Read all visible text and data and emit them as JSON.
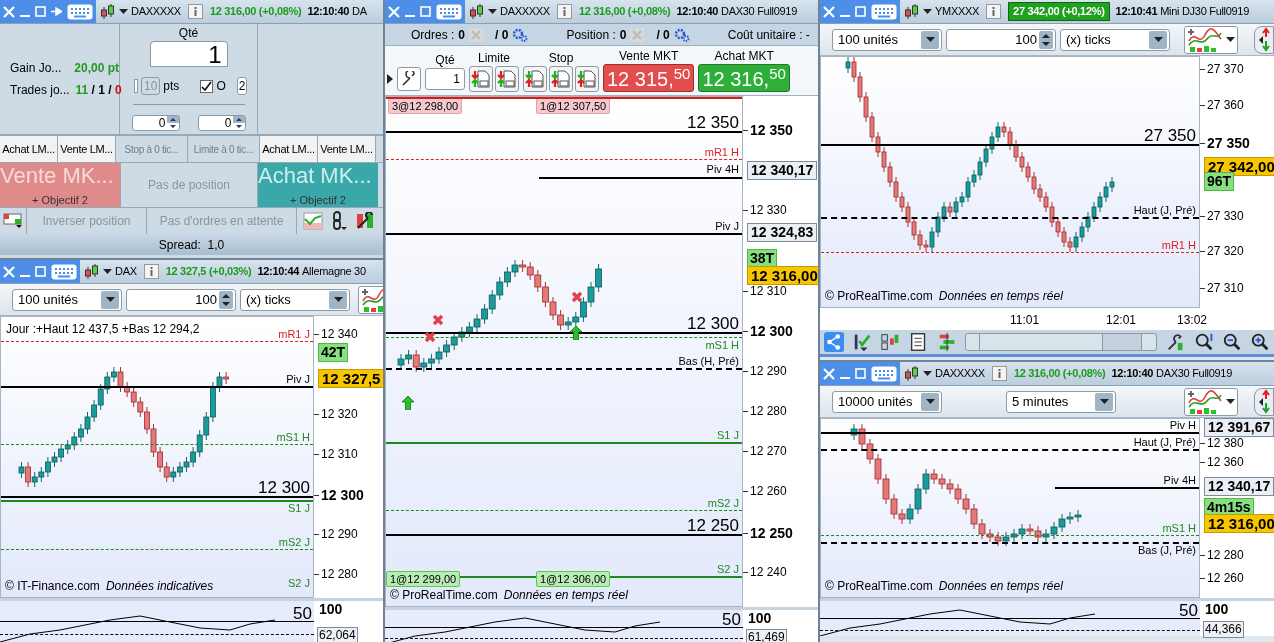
{
  "windows": [
    {
      "kind": "ticket",
      "title": {
        "symbol": "DAXXXXX",
        "price": "12 316,00 (+0,08%)",
        "time": "12:10:40",
        "name": "DA",
        "highlighted": false
      },
      "stats": [
        {
          "label": "Gain Jo...",
          "parts": [
            {
              "kind": "gain",
              "text": "20,00 pt"
            }
          ]
        },
        {
          "label": "Trades jo...",
          "parts": [
            {
              "kind": "gain",
              "text": "11"
            },
            {
              "kind": "neutral",
              "text": " / 1 / "
            },
            {
              "kind": "loss",
              "text": "0"
            }
          ]
        }
      ],
      "qty_label": "Qté",
      "qty": "1",
      "distance_enabled": false,
      "distance": "10",
      "distance_unit": "pts",
      "option": {
        "label": "O",
        "checked": true,
        "value": "2"
      },
      "spinners": [
        "0",
        "0"
      ],
      "order_buttons": [
        {
          "label": "Achat LM...",
          "disabled": false
        },
        {
          "label": "Vente LM...",
          "disabled": false
        },
        {
          "label": "Stop à 0 tic...",
          "disabled": true
        },
        {
          "label": "Limite à 0 tic...",
          "disabled": true
        },
        {
          "label": "Achat LM...",
          "disabled": false
        },
        {
          "label": "Vente LM...",
          "disabled": false
        }
      ],
      "sell": {
        "label": "Vente MK...",
        "sub": "+ Objectif 2"
      },
      "position": "Pas de position",
      "buy": {
        "label": "Achat MK...",
        "sub": "+ Objectif 2"
      },
      "actions": [
        {
          "label": "Inverser position",
          "disabled": true
        },
        {
          "label": "Pas d'ordres en attente",
          "disabled": true
        }
      ],
      "spread": "Spread:  1,0"
    },
    {
      "kind": "chart",
      "title": {
        "symbol": "DAX",
        "price": "12 327,5 (+0,03%)",
        "time": "12:10:44",
        "name": "Allemagne 30",
        "highlighted": false
      },
      "toolbar": [
        {
          "kind": "select",
          "value": "100 unités"
        },
        {
          "kind": "spinner",
          "value": "100"
        },
        {
          "kind": "select",
          "value": "(x) ticks"
        }
      ],
      "info": "Jour :+Haut 12 437,5 +Bas 12 294,2",
      "levels": [
        {
          "kind": "long-dash",
          "label": "mR1 J",
          "color": "#e02020"
        },
        {
          "kind": "solid",
          "label": "Piv J",
          "color": "#000000"
        },
        {
          "kind": "long-dash",
          "label": "mS1 H",
          "color": "#1e8a1e"
        },
        {
          "kind": "round",
          "label": "12 300",
          "color": "#000000"
        },
        {
          "kind": "line",
          "label": "S1 J",
          "color": "#1e8a1e"
        },
        {
          "kind": "long-dash",
          "label": "mS2 J",
          "color": "#1e8a1e"
        },
        {
          "kind": "label",
          "label": "S2 J",
          "color": "#1e8a1e"
        }
      ],
      "axis": [
        {
          "text": "12 340",
          "bold": false
        },
        {
          "text": "12 320",
          "bold": false
        },
        {
          "text": "12 310",
          "bold": false
        },
        {
          "text": "12 300",
          "bold": true
        },
        {
          "text": "12 290",
          "bold": false
        },
        {
          "text": "12 280",
          "bold": false
        }
      ],
      "tags": [
        {
          "kind": "timer",
          "text": "42T"
        },
        {
          "kind": "last",
          "text": "12 327,5"
        }
      ],
      "footer": {
        "source": "© IT-Finance.com",
        "note": "Données indicatives"
      },
      "indicator": {
        "max": "100",
        "mid": "50",
        "value": "62,064"
      }
    },
    {
      "kind": "chart",
      "title": {
        "symbol": "DAXXXXX",
        "price": "12 316,00 (+0,08%)",
        "time": "12:10:40",
        "name": "DAX30 Full0919",
        "highlighted": false
      },
      "order_bar": [
        {
          "label": "Ordres :",
          "count": "0",
          "pending": "/ 0"
        },
        {
          "label": "Position :",
          "count": "0",
          "pending": "/ 0"
        }
      ],
      "unit_cost": "Coût unitaire : -",
      "trade_bar": {
        "qty_label": "Qté",
        "qty": "1",
        "limit_label": "Limite",
        "stop_label": "Stop",
        "sell_label": "Vente MKT",
        "sell_price": "12 315,$^{50}$",
        "buy_label": "Achat MKT",
        "buy_price": "12 316,$^{50}$"
      },
      "order_tags": [
        {
          "kind": "stop",
          "text": "3@12 298,00"
        },
        {
          "kind": "stop",
          "text": "1@12 307,50"
        },
        {
          "kind": "target",
          "text": "1@12 299,00"
        },
        {
          "kind": "target",
          "text": "1@12 306,00"
        }
      ],
      "levels": [
        {
          "kind": "round",
          "label": "12 350",
          "color": "#000000"
        },
        {
          "kind": "long-dash",
          "label": "mR1 H",
          "color": "#e02020"
        },
        {
          "kind": "label",
          "label": "Piv 4H",
          "color": "#000000"
        },
        {
          "kind": "solid",
          "color": "#000000"
        },
        {
          "kind": "solid",
          "label": "Piv J",
          "color": "#000000"
        },
        {
          "kind": "round",
          "label": "12 300",
          "color": "#000000"
        },
        {
          "kind": "long-dash",
          "label": "mS1 H",
          "color": "#1e8a1e"
        },
        {
          "kind": "dashed",
          "label": "Bas (H, Pré)",
          "color": "#000000"
        },
        {
          "kind": "line",
          "label": "S1 J",
          "color": "#1e8a1e"
        },
        {
          "kind": "long-dash",
          "label": "mS2 J",
          "color": "#1e8a1e"
        },
        {
          "kind": "round",
          "label": "12 250",
          "color": "#000000"
        },
        {
          "kind": "line",
          "label": "S2 J",
          "color": "#1e8a1e"
        }
      ],
      "axis": [
        {
          "text": "12 350",
          "bold": true
        },
        {
          "text": "12 330",
          "bold": false
        },
        {
          "text": "12 310",
          "bold": false
        },
        {
          "text": "12 300",
          "bold": true
        },
        {
          "text": "12 290",
          "bold": false
        },
        {
          "text": "12 280",
          "bold": false
        },
        {
          "text": "12 270",
          "bold": false
        },
        {
          "text": "12 260",
          "bold": false
        },
        {
          "text": "12 250",
          "bold": true
        },
        {
          "text": "12 240",
          "bold": false
        }
      ],
      "tags": [
        {
          "kind": "level",
          "text": "12 340,17"
        },
        {
          "kind": "level",
          "text": "12 324,83"
        },
        {
          "kind": "timer",
          "text": "38T"
        },
        {
          "kind": "last",
          "text": "12 316,00"
        }
      ],
      "footer": {
        "source": "© ProRealTime.com",
        "note": "Données en temps réel"
      },
      "indicator": {
        "max": "100",
        "mid": "50",
        "value": "61,469"
      }
    },
    {
      "kind": "chart",
      "title": {
        "symbol": "YMXXXX",
        "price": "27 342,00 (+0,12%)",
        "time": "12:10:41",
        "name": "Mini DJ30 Full0919",
        "highlighted": true
      },
      "toolbar": [
        {
          "kind": "select",
          "value": "100 unités"
        },
        {
          "kind": "spinner",
          "value": "100"
        },
        {
          "kind": "select",
          "value": "(x) ticks"
        }
      ],
      "levels": [
        {
          "kind": "round",
          "label": "27 350",
          "color": "#000000"
        },
        {
          "kind": "dashed",
          "label": "Haut (J, Pré)",
          "color": "#000000"
        },
        {
          "kind": "long-dash",
          "label": "mR1 H",
          "color": "#e02020"
        }
      ],
      "axis": [
        {
          "text": "27 370",
          "bold": false
        },
        {
          "text": "27 360",
          "bold": false
        },
        {
          "text": "27 350",
          "bold": true
        },
        {
          "text": "27 330",
          "bold": false
        },
        {
          "text": "27 320",
          "bold": false
        },
        {
          "text": "27 310",
          "bold": false
        }
      ],
      "tags": [
        {
          "kind": "last",
          "text": "27 342,00"
        },
        {
          "kind": "timer",
          "text": "96T"
        }
      ],
      "footer": {
        "source": "© ProRealTime.com",
        "note": "Données en temps réel"
      },
      "time_axis": [
        "11:01",
        "12:01",
        "13:02"
      ]
    },
    {
      "kind": "chart",
      "title": {
        "symbol": "DAXXXXX",
        "price": "12 316,00 (+0,08%)",
        "time": "12:10:40",
        "name": "DAX30 Full0919",
        "highlighted": false
      },
      "toolbar": [
        {
          "kind": "select",
          "value": "10000 unités"
        },
        {
          "kind": "select",
          "value": "5 minutes"
        }
      ],
      "levels": [
        {
          "kind": "solid",
          "label": "Piv H",
          "color": "#000000"
        },
        {
          "kind": "dashed",
          "label": "Haut (J, Pré)",
          "color": "#000000"
        },
        {
          "kind": "solid",
          "label": "Piv 4H",
          "color": "#000000"
        },
        {
          "kind": "long-dash",
          "label": "mS1 H",
          "color": "#1e8a1e"
        },
        {
          "kind": "dashed",
          "label": "Bas (J, Pré)",
          "color": "#000000"
        }
      ],
      "axis": [
        {
          "text": "12 380",
          "bold": false
        },
        {
          "text": "12 360",
          "bold": false
        },
        {
          "text": "12 280",
          "bold": false
        },
        {
          "text": "12 260",
          "bold": false
        }
      ],
      "tags": [
        {
          "kind": "level",
          "text": "12 391,67"
        },
        {
          "kind": "level",
          "text": "12 340,17"
        },
        {
          "kind": "timer",
          "text": "4m15s"
        },
        {
          "kind": "last",
          "text": "12 316,00"
        }
      ],
      "footer": {
        "source": "© ProRealTime.com",
        "note": "Données en temps réel"
      },
      "indicator": {
        "max": "100",
        "mid": "50",
        "value": "44,366"
      }
    }
  ]
}
